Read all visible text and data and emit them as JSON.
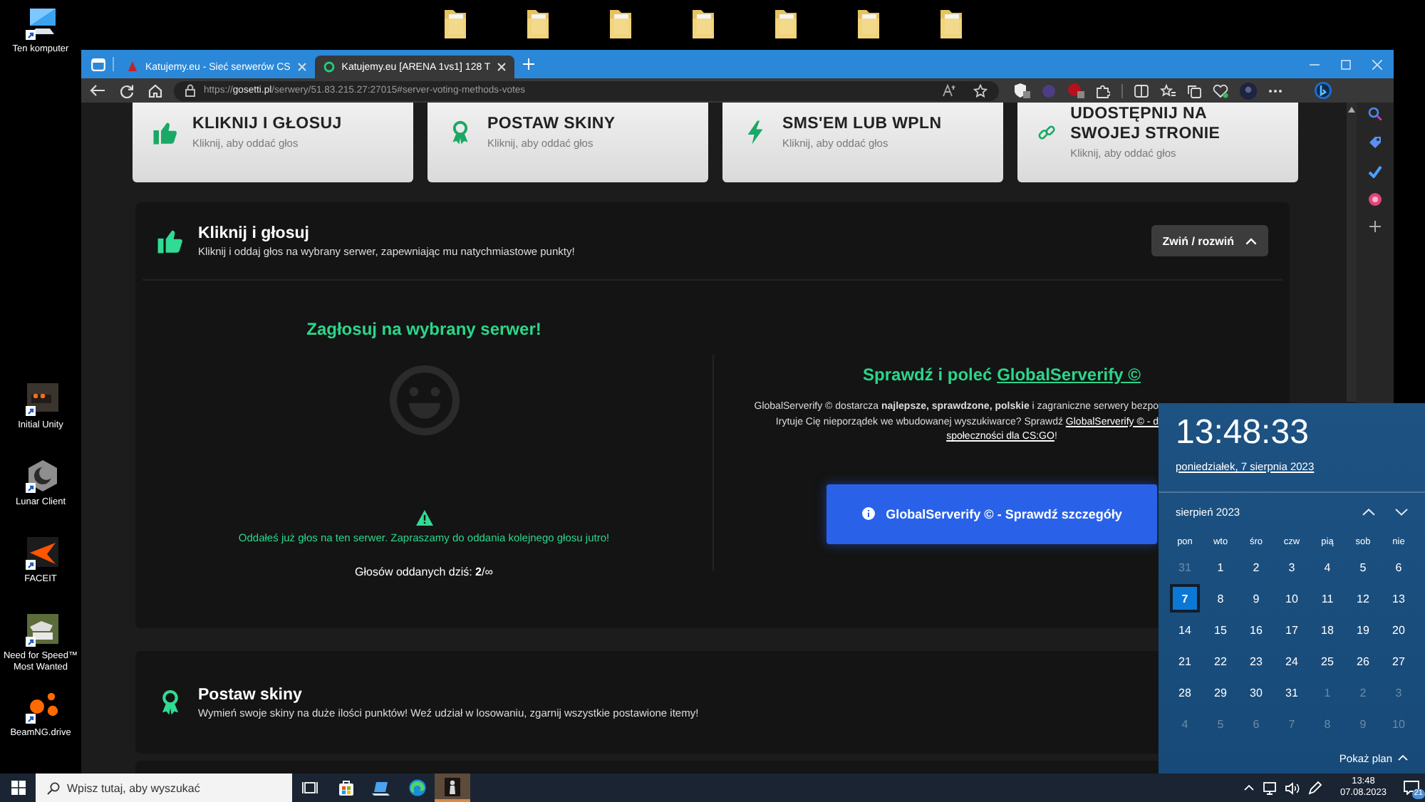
{
  "desktop": {
    "top_icon": {
      "label": "Ten komputer",
      "kind": "computer"
    },
    "icons": [
      {
        "label": "Initial Unity",
        "kind": "car"
      },
      {
        "label": "Lunar Client",
        "kind": "moon"
      },
      {
        "label": "FACEIT",
        "kind": "arrow"
      },
      {
        "label": "Need for Speed™ Most Wanted",
        "kind": "race"
      },
      {
        "label": "BeamNG.drive",
        "kind": "dots"
      }
    ]
  },
  "browser": {
    "tabs": [
      {
        "title": "Katujemy.eu - Sieć serwerów CS",
        "selected": false
      },
      {
        "title": "Katujemy.eu [ARENA 1vs1] 128 T",
        "selected": true
      }
    ],
    "address": {
      "scheme": "https://",
      "host": "gosetti.pl",
      "path": "/serwery/51.83.215.27:27015#server-voting-methods-votes"
    }
  },
  "page": {
    "vote_methods": [
      {
        "title": "KLIKNIJ I GŁOSUJ",
        "subtitle": "Kliknij, aby oddać głos",
        "kind": "thumb"
      },
      {
        "title": "POSTAW SKINY",
        "subtitle": "Kliknij, aby oddać głos",
        "kind": "award"
      },
      {
        "title": "SMS'EM LUB WPLN",
        "subtitle": "Kliknij, aby oddać głos",
        "kind": "bolt"
      },
      {
        "title": "UDOSTĘPNIJ NA SWOJEJ STRONIE",
        "subtitle": "Kliknij, aby oddać głos",
        "kind": "link"
      }
    ],
    "sections": [
      {
        "title": "Kliknij i głosuj",
        "subtitle": "Kliknij i oddaj głos na wybrany serwer, zapewniając mu natychmiastowe punkty!",
        "kind": "thumb",
        "toggle": "Zwiń / rozwiń",
        "expanded": true,
        "vote_panel": {
          "title": "Zagłosuj na wybrany serwer!",
          "notice": "Oddałeś już głos na ten serwer. Zapraszamy do oddania kolejnego głosu jutro!",
          "count": "Głosów oddanych dziś: **2**/∞"
        },
        "promo_panel": {
          "title": "Sprawdź i poleć",
          "title_link": "GlobalServerify ©",
          "lines": [
            {
              "kind": "clipped",
              "parts": [
                {
                  "text": "GlobalServerify © dostarcza **najlepsze, sprawdzone, polskie** i zagraniczne serwery bezpo"
                }
              ]
            },
            {
              "kind": "clipped",
              "parts": [
                {
                  "text": "Irytuje Cię nieporządek we wbudowanej wyszukiwarce? Sprawdź"
                },
                {
                  "text": "GlobalServerify © - d",
                  "link": true
                }
              ]
            },
            {
              "kind": "whole",
              "parts": [
                {
                  "text": "społeczności dla CS:GO",
                  "link": true
                },
                {
                  "text": "!"
                }
              ]
            }
          ],
          "button": "GlobalServerify © - Sprawdź szczegóły"
        }
      },
      {
        "title": "Postaw skiny",
        "subtitle": "Wymień swoje skiny na duże ilości punktów! Weź udział w losowaniu, zgarnij wszystkie postawione itemy!",
        "kind": "award",
        "expanded": false
      }
    ]
  },
  "calendar": {
    "time": "13:48:33",
    "date": "poniedziałek, 7 sierpnia 2023",
    "month": "sierpień 2023",
    "weekdays": [
      "pon",
      "wto",
      "śro",
      "czw",
      "pią",
      "sob",
      "nie"
    ],
    "weeks": [
      [
        {
          "day": "31",
          "outside_month": true,
          "selected": false
        },
        {
          "day": "1",
          "outside_month": false,
          "selected": false
        },
        {
          "day": "2",
          "outside_month": false,
          "selected": false
        },
        {
          "day": "3",
          "outside_month": false,
          "selected": false
        },
        {
          "day": "4",
          "outside_month": false,
          "selected": false
        },
        {
          "day": "5",
          "outside_month": false,
          "selected": false
        },
        {
          "day": "6",
          "outside_month": false,
          "selected": false
        }
      ],
      [
        {
          "day": "7",
          "outside_month": false,
          "selected": true
        },
        {
          "day": "8",
          "outside_month": false,
          "selected": false
        },
        {
          "day": "9",
          "outside_month": false,
          "selected": false
        },
        {
          "day": "10",
          "outside_month": false,
          "selected": false
        },
        {
          "day": "11",
          "outside_month": false,
          "selected": false
        },
        {
          "day": "12",
          "outside_month": false,
          "selected": false
        },
        {
          "day": "13",
          "outside_month": false,
          "selected": false
        }
      ],
      [
        {
          "day": "14",
          "outside_month": false,
          "selected": false
        },
        {
          "day": "15",
          "outside_month": false,
          "selected": false
        },
        {
          "day": "16",
          "outside_month": false,
          "selected": false
        },
        {
          "day": "17",
          "outside_month": false,
          "selected": false
        },
        {
          "day": "18",
          "outside_month": false,
          "selected": false
        },
        {
          "day": "19",
          "outside_month": false,
          "selected": false
        },
        {
          "day": "20",
          "outside_month": false,
          "selected": false
        }
      ],
      [
        {
          "day": "21",
          "outside_month": false,
          "selected": false
        },
        {
          "day": "22",
          "outside_month": false,
          "selected": false
        },
        {
          "day": "23",
          "outside_month": false,
          "selected": false
        },
        {
          "day": "24",
          "outside_month": false,
          "selected": false
        },
        {
          "day": "25",
          "outside_month": false,
          "selected": false
        },
        {
          "day": "26",
          "outside_month": false,
          "selected": false
        },
        {
          "day": "27",
          "outside_month": false,
          "selected": false
        }
      ],
      [
        {
          "day": "28",
          "outside_month": false,
          "selected": false
        },
        {
          "day": "29",
          "outside_month": false,
          "selected": false
        },
        {
          "day": "30",
          "outside_month": false,
          "selected": false
        },
        {
          "day": "31",
          "outside_month": false,
          "selected": false
        },
        {
          "day": "1",
          "outside_month": true,
          "selected": false
        },
        {
          "day": "2",
          "outside_month": true,
          "selected": false
        },
        {
          "day": "3",
          "outside_month": true,
          "selected": false
        }
      ],
      [
        {
          "day": "4",
          "outside_month": true,
          "selected": false
        },
        {
          "day": "5",
          "outside_month": true,
          "selected": false
        },
        {
          "day": "6",
          "outside_month": true,
          "selected": false
        },
        {
          "day": "7",
          "outside_month": true,
          "selected": false
        },
        {
          "day": "8",
          "outside_month": true,
          "selected": false
        },
        {
          "day": "9",
          "outside_month": true,
          "selected": false
        },
        {
          "day": "10",
          "outside_month": true,
          "selected": false
        }
      ]
    ],
    "agenda_toggle": "Pokaż plan"
  },
  "taskbar": {
    "search": {
      "placeholder": "Wpisz tutaj, aby wyszukać"
    },
    "apps": [
      {
        "kind": "task-view",
        "active": false
      },
      {
        "kind": "store",
        "active": false
      },
      {
        "kind": "laptop",
        "active": false
      },
      {
        "kind": "browser",
        "active": false
      },
      {
        "kind": "figure",
        "active": true
      }
    ],
    "clock": {
      "time": "13:48",
      "date": "07.08.2023"
    },
    "notification_count": "21"
  }
}
